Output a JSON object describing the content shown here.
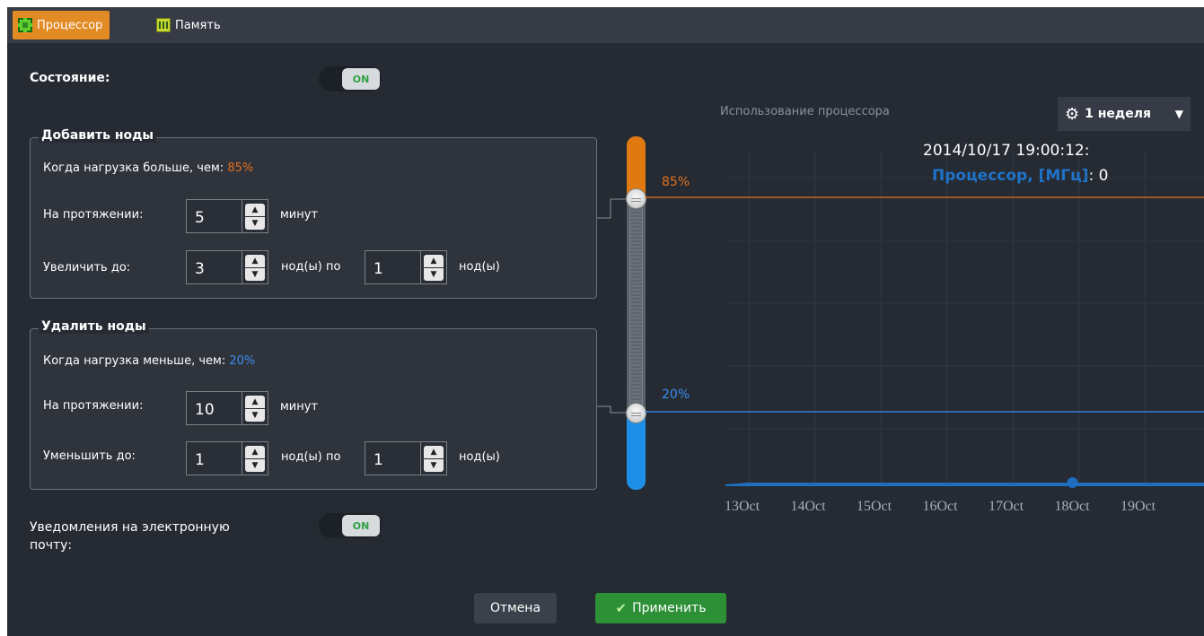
{
  "tabs": [
    {
      "label": "Процессор",
      "icon": "cpu-icon",
      "active": true
    },
    {
      "label": "Память",
      "icon": "memory-icon",
      "active": false
    }
  ],
  "state": {
    "label": "Состояние:",
    "toggle": "ON"
  },
  "add_nodes": {
    "legend": "Добавить ноды",
    "when_label": "Когда нагрузка больше, чем:",
    "threshold": "85%",
    "duration_label": "На протяжении:",
    "duration_value": "5",
    "duration_unit": "минут",
    "change_label": "Увеличить до:",
    "change_to": "3",
    "nodes_by": "нод(ы) по",
    "step": "1",
    "nodes": "нод(ы)"
  },
  "remove_nodes": {
    "legend": "Удалить ноды",
    "when_label": "Когда нагрузка меньше, чем:",
    "threshold": "20%",
    "duration_label": "На протяжении:",
    "duration_value": "10",
    "duration_unit": "минут",
    "change_label": "Уменьшить до:",
    "change_to": "1",
    "nodes_by": "нод(ы) по",
    "step": "1",
    "nodes": "нод(ы)"
  },
  "slider": {
    "upper": "85%",
    "lower": "20%"
  },
  "email": {
    "label_line1": "Уведомления на электронную",
    "label_line2": "почту:",
    "toggle": "ON"
  },
  "buttons": {
    "cancel": "Отмена",
    "apply": "Применить"
  },
  "colors": {
    "orange": "#e5701b",
    "blue": "#3a8ef0",
    "accent_tab": "#e28a24",
    "apply_green": "#2d8f36"
  },
  "chart": {
    "title": "Использование процессора",
    "period": "1 неделя",
    "tooltip_time": "2014/10/17 19:00:12:",
    "tooltip_series": "Процессор, [МГц]",
    "tooltip_value": ": 0"
  },
  "chart_data": {
    "type": "area",
    "title": "Использование процессора",
    "x": [
      "13Oct",
      "14Oct",
      "15Oct",
      "16Oct",
      "17Oct",
      "18Oct",
      "19Oct"
    ],
    "series": [
      {
        "name": "Процессор, [МГц]",
        "values": [
          0,
          0,
          0,
          0,
          0,
          0,
          0
        ]
      }
    ],
    "threshold_lines": [
      {
        "label": "85%",
        "value": 85,
        "color": "#e5701b"
      },
      {
        "label": "20%",
        "value": 20,
        "color": "#3a8ef0"
      }
    ],
    "ylim": [
      0,
      100
    ],
    "grid": true
  }
}
